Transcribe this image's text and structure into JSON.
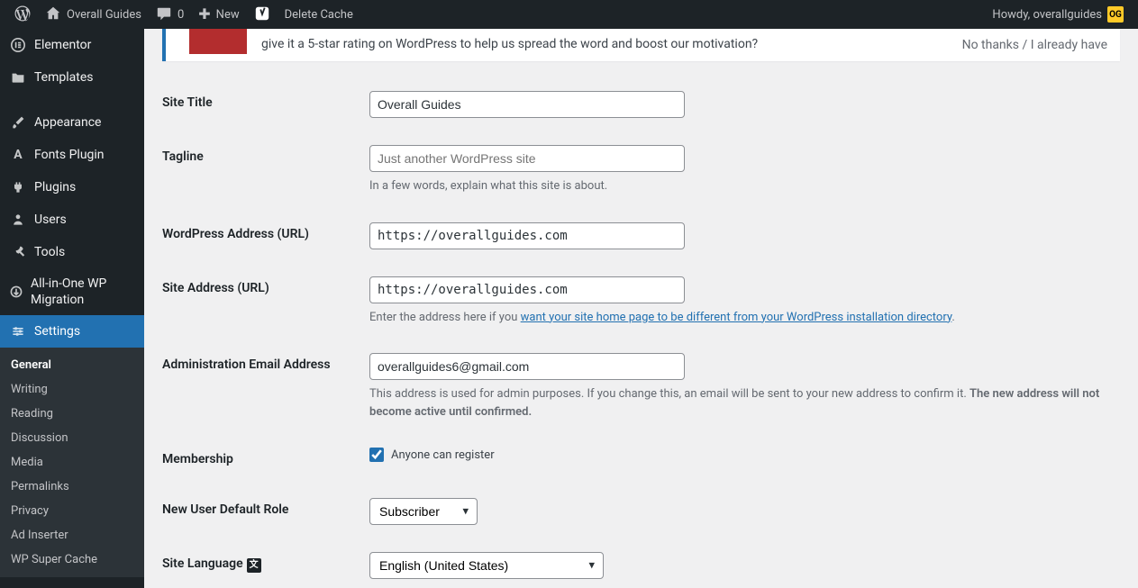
{
  "adminbar": {
    "site_name": "Overall Guides",
    "comments": "0",
    "new": "New",
    "delete_cache": "Delete Cache",
    "howdy": "Howdy, overallguides"
  },
  "sidebar": {
    "items": [
      {
        "label": "Elementor"
      },
      {
        "label": "Templates"
      },
      {
        "label": "Appearance"
      },
      {
        "label": "Fonts Plugin"
      },
      {
        "label": "Plugins"
      },
      {
        "label": "Users"
      },
      {
        "label": "Tools"
      },
      {
        "label": "All-in-One WP Migration"
      },
      {
        "label": "Settings"
      }
    ],
    "submenu": [
      {
        "label": "General"
      },
      {
        "label": "Writing"
      },
      {
        "label": "Reading"
      },
      {
        "label": "Discussion"
      },
      {
        "label": "Media"
      },
      {
        "label": "Permalinks"
      },
      {
        "label": "Privacy"
      },
      {
        "label": "Ad Inserter"
      },
      {
        "label": "WP Super Cache"
      }
    ]
  },
  "notice": {
    "text": "give it a 5-star rating on WordPress to help us spread the word and boost our motivation?",
    "dismiss": "No thanks / I already have"
  },
  "form": {
    "site_title": {
      "label": "Site Title",
      "value": "Overall Guides"
    },
    "tagline": {
      "label": "Tagline",
      "placeholder": "Just another WordPress site",
      "help": "In a few words, explain what this site is about."
    },
    "wp_url": {
      "label": "WordPress Address (URL)",
      "value": "https://overallguides.com"
    },
    "site_url": {
      "label": "Site Address (URL)",
      "value": "https://overallguides.com",
      "help_pre": "Enter the address here if you ",
      "help_link": "want your site home page to be different from your WordPress installation directory",
      "help_post": "."
    },
    "admin_email": {
      "label": "Administration Email Address",
      "value": "overallguides6@gmail.com",
      "help": "This address is used for admin purposes. If you change this, an email will be sent to your new address to confirm it. ",
      "help_strong": "The new address will not become active until confirmed."
    },
    "membership": {
      "label": "Membership",
      "checkbox": "Anyone can register"
    },
    "default_role": {
      "label": "New User Default Role",
      "value": "Subscriber"
    },
    "site_lang": {
      "label": "Site Language",
      "value": "English (United States)"
    }
  }
}
